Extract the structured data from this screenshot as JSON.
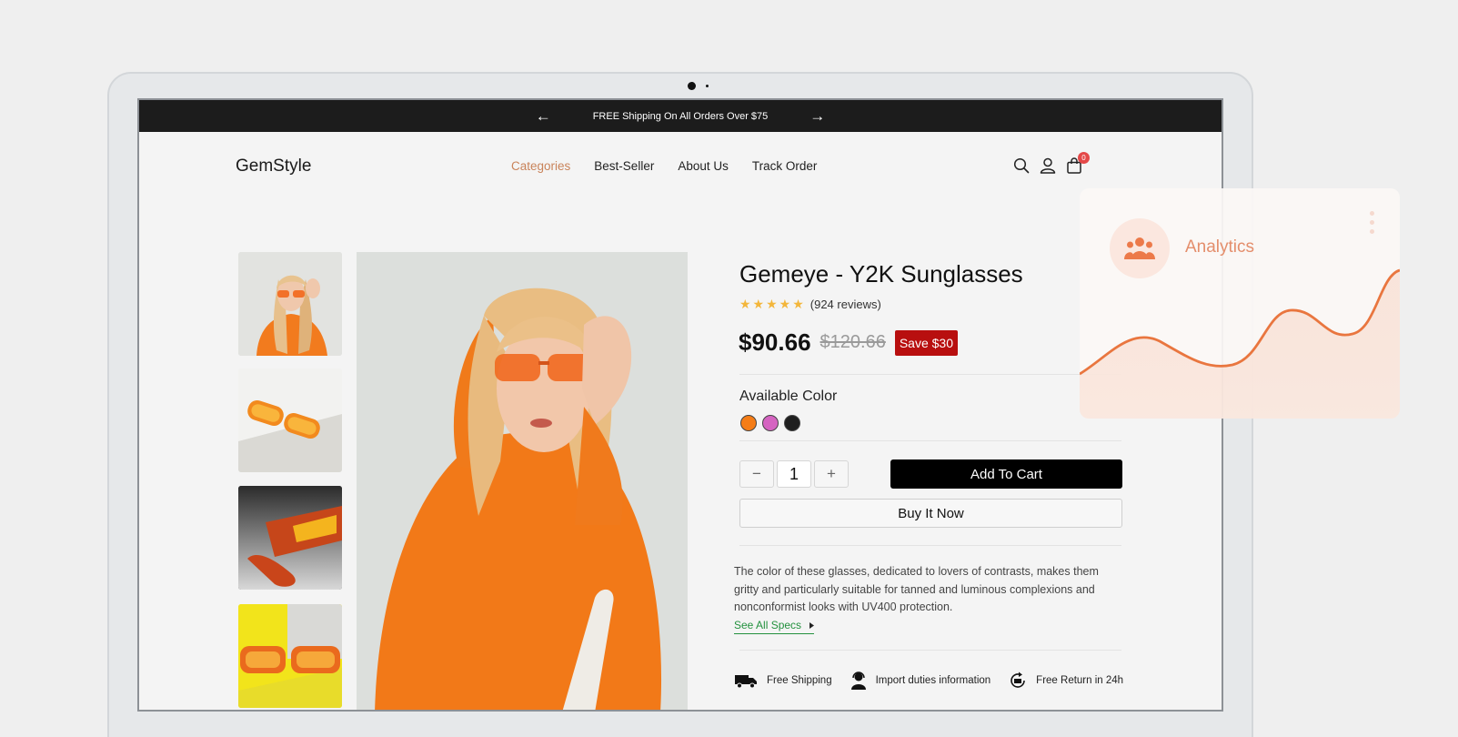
{
  "announcement": {
    "text": "FREE Shipping On All Orders Over $75",
    "prev_icon": "arrow-left-icon",
    "next_icon": "arrow-right-icon"
  },
  "header": {
    "logo": "GemStyle",
    "nav": [
      {
        "label": "Categories",
        "active": true
      },
      {
        "label": "Best-Seller",
        "active": false
      },
      {
        "label": "About Us",
        "active": false
      },
      {
        "label": "Track Order",
        "active": false
      }
    ],
    "icons": [
      "search-icon",
      "user-icon",
      "cart-icon"
    ],
    "cart_count": "0"
  },
  "gallery": {
    "thumbnails": [
      "model-in-orange-hoodie",
      "orange-sunglasses-on-white",
      "red-sunglasses-dark-background",
      "orange-sunglasses-yellow-background"
    ],
    "main_image": "model-in-orange-hoodie-with-sunglasses"
  },
  "product": {
    "title": "Gemeye - Y2K Sunglasses",
    "stars": "★★★★★",
    "reviews": "(924 reviews)",
    "price": "$90.66",
    "old_price": "$120.66",
    "save": "Save $30",
    "color_label": "Available Color",
    "colors": [
      "#f57d17",
      "#d564c1",
      "#1f1f1f"
    ],
    "qty_minus": "−",
    "quantity": "1",
    "qty_plus": "+",
    "add_to_cart": "Add To Cart",
    "buy_now": "Buy It Now",
    "description": "The color of these glasses, dedicated to lovers of contrasts, makes them gritty and particularly suitable for tanned and luminous complexions and nonconformist looks with UV400 protection.",
    "specs_link": "See All Specs"
  },
  "features": [
    {
      "icon": "truck-icon",
      "label": "Free Shipping"
    },
    {
      "icon": "support-agent-icon",
      "label": "Import duties information"
    },
    {
      "icon": "return-24h-icon",
      "label": "Free Return in 24h"
    }
  ],
  "analytics": {
    "title": "Analytics",
    "icon": "users-icon",
    "accent": "#e9763f"
  },
  "colors": {
    "accent_nav": "#c9835a",
    "save_badge": "#b80f0f",
    "specs_link": "#23913e"
  }
}
